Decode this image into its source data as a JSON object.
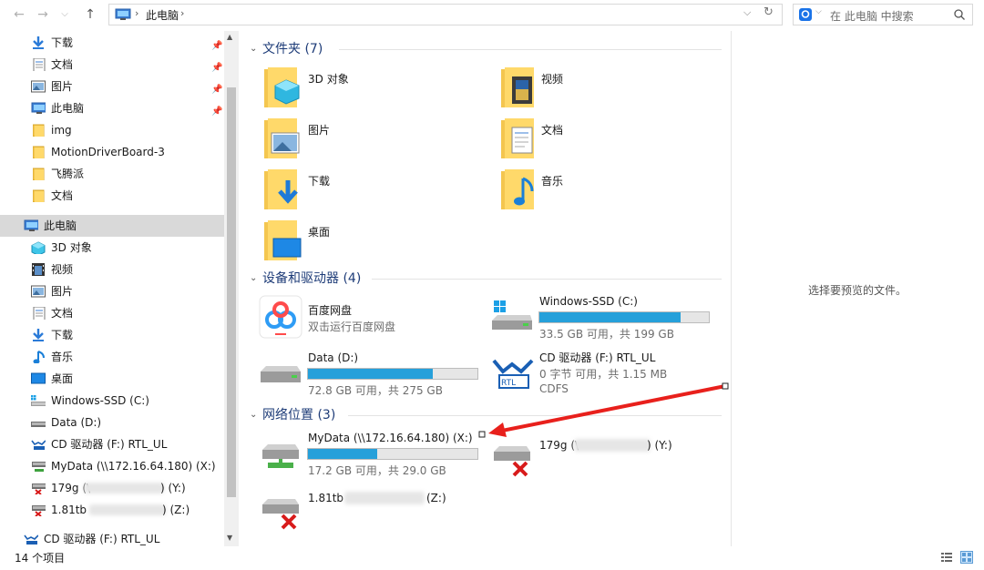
{
  "address": {
    "segment": "此电脑",
    "search_placeholder": "在 此电脑 中搜索"
  },
  "sidebar": {
    "quick": [
      {
        "label": "下载",
        "icon": "download-icon"
      },
      {
        "label": "文档",
        "icon": "document-icon"
      },
      {
        "label": "图片",
        "icon": "picture-icon"
      },
      {
        "label": "此电脑",
        "icon": "computer-icon"
      },
      {
        "label": "img",
        "icon": "folder-icon"
      },
      {
        "label": "MotionDriverBoard-3",
        "icon": "folder-icon"
      },
      {
        "label": "飞腾派",
        "icon": "folder-icon"
      },
      {
        "label": "文档",
        "icon": "folder-icon"
      }
    ],
    "thispc": "此电脑",
    "pc_items": [
      {
        "label": "3D 对象",
        "icon": "3d-objects-icon"
      },
      {
        "label": "视频",
        "icon": "video-icon"
      },
      {
        "label": "图片",
        "icon": "picture-icon"
      },
      {
        "label": "文档",
        "icon": "document-icon"
      },
      {
        "label": "下载",
        "icon": "download-icon"
      },
      {
        "label": "音乐",
        "icon": "music-icon"
      },
      {
        "label": "桌面",
        "icon": "desktop-icon"
      },
      {
        "label": "Windows-SSD (C:)",
        "icon": "ssd-drive-icon"
      },
      {
        "label": "Data (D:)",
        "icon": "drive-icon"
      },
      {
        "label": "CD 驱动器 (F:) RTL_UL",
        "icon": "cd-drive-icon"
      },
      {
        "label": "MyData (\\\\172.16.64.180) (X:)",
        "icon": "network-drive-icon"
      },
      {
        "label": "179g (\\",
        "suffix": ") (Y:)",
        "icon": "network-drive-disconnected-icon"
      },
      {
        "label": "1.81tb",
        "suffix": ") (Z:)",
        "icon": "network-drive-disconnected-icon"
      }
    ],
    "cd_bottom": "CD 驱动器 (F:) RTL_UL"
  },
  "sections": {
    "folders": {
      "title": "文件夹 (7)",
      "items": [
        {
          "label": "3D 对象"
        },
        {
          "label": "视频"
        },
        {
          "label": "图片"
        },
        {
          "label": "文档"
        },
        {
          "label": "下载"
        },
        {
          "label": "音乐"
        },
        {
          "label": "桌面"
        }
      ]
    },
    "devices": {
      "title": "设备和驱动器 (4)",
      "baidu": {
        "name": "百度网盘",
        "sub": "双击运行百度网盘"
      },
      "c": {
        "name": "Windows-SSD (C:)",
        "sub": "33.5 GB 可用，共 199 GB",
        "used": 0.832
      },
      "d": {
        "name": "Data (D:)",
        "sub": "72.8 GB 可用，共 275 GB",
        "used": 0.735
      },
      "f": {
        "name": "CD 驱动器 (F:) RTL_UL",
        "sub": "0 字节 可用，共 1.15 MB",
        "sub2": "CDFS"
      }
    },
    "network": {
      "title": "网络位置 (3)",
      "x": {
        "name": "MyData (\\\\172.16.64.180) (X:)",
        "sub": "17.2 GB 可用，共 29.0 GB",
        "used": 0.407
      },
      "y": {
        "name": "179g (\\",
        "suffix": ") (Y:)"
      },
      "z": {
        "name": "1.81tb",
        "suffix": " (Z:)"
      }
    }
  },
  "preview_text": "选择要预览的文件。",
  "status_text": "14 个项目"
}
